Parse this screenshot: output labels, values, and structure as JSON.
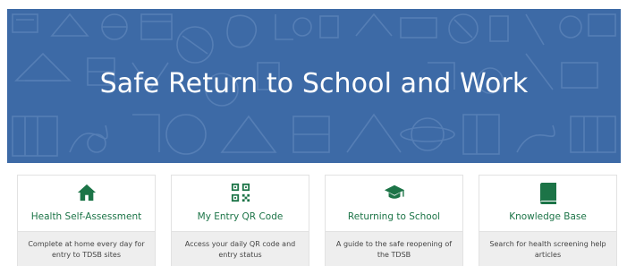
{
  "hero": {
    "title": "Safe Return to School and Work"
  },
  "colors": {
    "hero_background": "#3d6aa6",
    "accent_green": "#1c7447",
    "card_footer": "#eeeeee"
  },
  "cards": [
    {
      "title": "Health Self-Assessment",
      "description": "Complete at home every day for entry to TDSB sites",
      "icon": "home-icon"
    },
    {
      "title": "My Entry QR Code",
      "description": "Access your daily QR code and entry status",
      "icon": "qr-code-icon"
    },
    {
      "title": "Returning to School",
      "description": "A guide to the safe reopening of the TDSB",
      "icon": "graduation-cap-icon"
    },
    {
      "title": "Knowledge Base",
      "description": "Search for health screening help articles",
      "icon": "book-icon"
    }
  ]
}
